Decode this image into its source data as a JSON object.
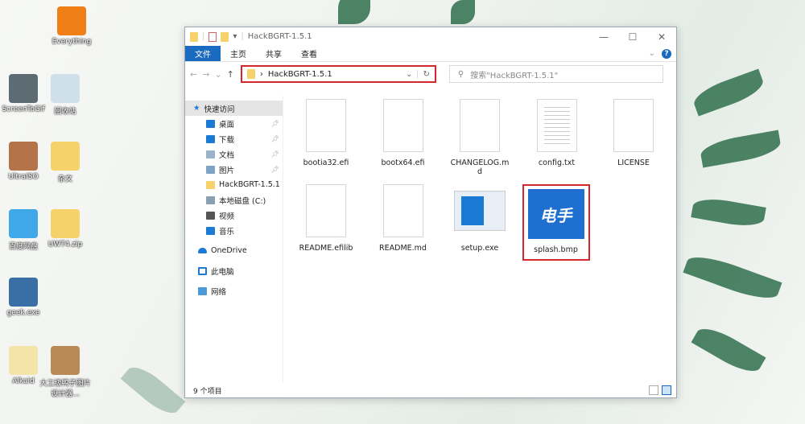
{
  "desktop": {
    "icons": [
      {
        "label": "Everything",
        "color": "#f07f18"
      },
      {
        "label": "ScreenToGif",
        "color": "#5d6b73"
      },
      {
        "label": "回收站",
        "color": "#cfe0ea"
      },
      {
        "label": "UltraISO",
        "color": "#b5734a"
      },
      {
        "label": "杂文",
        "color": "#f5d26a"
      },
      {
        "label": "百度网盘",
        "color": "#3fa8e8"
      },
      {
        "label": "UWT4.zip",
        "color": "#f5d26a"
      },
      {
        "label": "geek.exe",
        "color": "#3a6fa6"
      },
      {
        "label": "Alkaid",
        "color": "#f5e4a8"
      },
      {
        "label": "大工级鸭子图片设计器...",
        "color": "#b88a55"
      }
    ]
  },
  "window": {
    "title": "HackBGRT-1.5.1",
    "controls": {
      "minimize": "—",
      "maximize": "☐",
      "close": "✕"
    },
    "ribbon": {
      "file": "文件",
      "tabs": [
        "主页",
        "共享",
        "查看"
      ],
      "help": "?"
    },
    "address": {
      "path": "HackBGRT-1.5.1",
      "search_placeholder": "搜索\"HackBGRT-1.5.1\""
    },
    "nav": {
      "quick_access": "快速访问",
      "items": [
        {
          "label": "桌面",
          "color": "#1a7ad4",
          "pinned": true
        },
        {
          "label": "下载",
          "color": "#1a7ad4",
          "pinned": true
        },
        {
          "label": "文档",
          "color": "#9bb4cc",
          "pinned": true
        },
        {
          "label": "图片",
          "color": "#7fa3c7",
          "pinned": true
        },
        {
          "label": "HackBGRT-1.5.1",
          "color": "#f5d26a",
          "pinned": false
        },
        {
          "label": "本地磁盘 (C:)",
          "color": "#8aa0b0",
          "pinned": false
        },
        {
          "label": "视频",
          "color": "#555",
          "pinned": false
        },
        {
          "label": "音乐",
          "color": "#1a7ad4",
          "pinned": false
        }
      ],
      "onedrive": "OneDrive",
      "this_pc": "此电脑",
      "network": "网络"
    },
    "files": [
      {
        "name": "bootia32.efi",
        "type": "blank"
      },
      {
        "name": "bootx64.efi",
        "type": "blank"
      },
      {
        "name": "CHANGELOG.md",
        "type": "blank"
      },
      {
        "name": "config.txt",
        "type": "text"
      },
      {
        "name": "LICENSE",
        "type": "blank"
      },
      {
        "name": "README.efilib",
        "type": "blank"
      },
      {
        "name": "README.md",
        "type": "blank"
      },
      {
        "name": "setup.exe",
        "type": "exe"
      },
      {
        "name": "splash.bmp",
        "type": "bmp",
        "thumb_text": "电手",
        "highlighted": true
      }
    ],
    "status": "9 个项目"
  }
}
